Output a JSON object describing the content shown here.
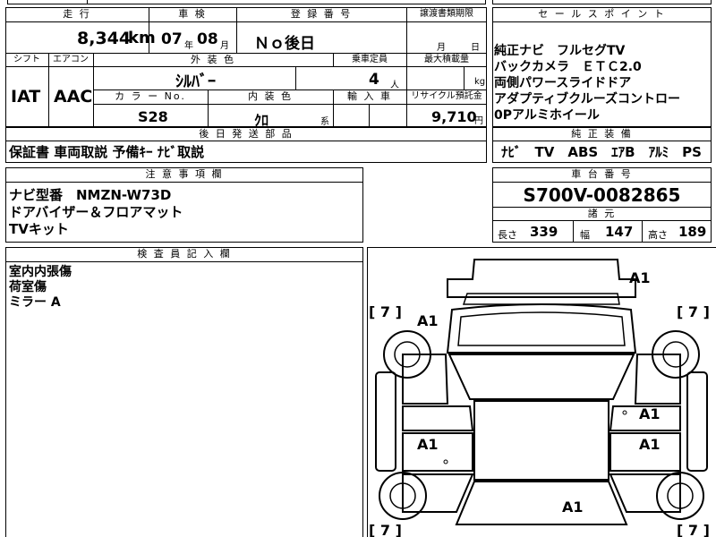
{
  "top_strip": {
    "partial_text": "..."
  },
  "headers": {
    "mileage": "走 行",
    "inspection": "車 検",
    "registration": "登 録 番 号",
    "transfer_deadline": "譲渡書類期限",
    "sales_points": "セ ー ル ス ポ イ ン ト",
    "shift": "シフト",
    "aircon": "エアコン",
    "exterior_color": "外 装 色",
    "capacity": "乗車定員",
    "max_load": "最大積載量",
    "color_no": "カ ラ ー No.",
    "interior_color": "内 装 色",
    "import": "輸 入 車",
    "recycle_fee": "リサイクル預託金",
    "later_parts": "後 日 発 送 部 品",
    "genuine_equipment": "純 正 装 備",
    "notes": "注 意 事 項 欄",
    "chassis_no": "車 台 番 号",
    "specs": "諸 元",
    "inspector_notes": "検 査 員 記 入 欄"
  },
  "vehicle": {
    "mileage_value": "8,344",
    "mileage_unit": "km",
    "inspection_year": "07",
    "inspection_year_unit": "年",
    "inspection_month": "08",
    "inspection_month_unit": "月",
    "registration": "Ｎｏ後日",
    "transfer_month_unit": "月",
    "transfer_day_unit": "日",
    "shift": "IAT",
    "aircon": "AAC",
    "exterior_color": "ｼﾙﾊﾞｰ",
    "capacity_value": "4",
    "capacity_unit": "人",
    "max_load_unit": "kg",
    "color_no": "S28",
    "interior_color": "ｸﾛ",
    "interior_suffix": "系",
    "recycle_value": "9,710",
    "recycle_unit": "円",
    "chassis_no": "S700V-0082865"
  },
  "sales_points": [
    "純正ナビ　フルセグTV",
    "バックカメラ　ＥＴＣ2.0",
    "両側パワースライドドア",
    "アダプティブクルーズコントロー",
    "0Pアルミホイール"
  ],
  "later_parts_text": "保証書 車両取説 予備ｷｰ ﾅﾋﾞ取説",
  "genuine_equipment_text": "ﾅﾋﾞ　TV　ABS　ｴｱB　ｱﾙﾐ　PS　PW",
  "notes_lines": [
    "ナビ型番　NMZN-W73D",
    "ドアバイザー＆フロアマット",
    "TVキット"
  ],
  "specs": {
    "length_label": "長さ",
    "length_value": "339",
    "width_label": "幅",
    "width_value": "147",
    "height_label": "高さ",
    "height_value": "189"
  },
  "inspector_lines": [
    "室内内張傷",
    "荷室傷",
    "ミラー A"
  ],
  "diagram": {
    "tire_tl": "[ 7 ]",
    "tire_tr": "[ 7 ]",
    "tire_bl": "[ 7 ]",
    "tire_br": "[ 7 ]",
    "mark_roof": "A1",
    "mark_front_left": "A1",
    "mark_right_door": "A1",
    "mark_left_rear_door": "A1",
    "mark_right_rear_door": "A1",
    "mark_bottom": "A1"
  }
}
